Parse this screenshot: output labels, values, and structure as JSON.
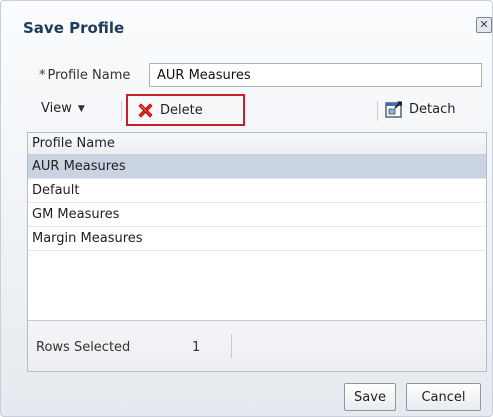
{
  "dialog": {
    "title": "Save Profile",
    "close_symbol": "✕"
  },
  "profile_name": {
    "required_marker": "*",
    "label": "Profile Name",
    "value": "AUR Measures"
  },
  "toolbar": {
    "view_label": "View",
    "view_chevron": "▼",
    "delete_label": "Delete",
    "delete_icon": "red-x-delete-icon",
    "detach_label": "Detach",
    "detach_icon": "detach-window-icon"
  },
  "table": {
    "column_header": "Profile Name",
    "rows": [
      {
        "name": "AUR Measures",
        "selected": true
      },
      {
        "name": "Default",
        "selected": false
      },
      {
        "name": "GM Measures",
        "selected": false
      },
      {
        "name": "Margin Measures",
        "selected": false
      }
    ],
    "footer_label": "Rows Selected",
    "rows_selected": "1"
  },
  "buttons": {
    "save": "Save",
    "cancel": "Cancel"
  },
  "colors": {
    "title": "#1e3c5a",
    "selected_row": "#c9d3e2",
    "highlight_border": "#c4202a"
  }
}
